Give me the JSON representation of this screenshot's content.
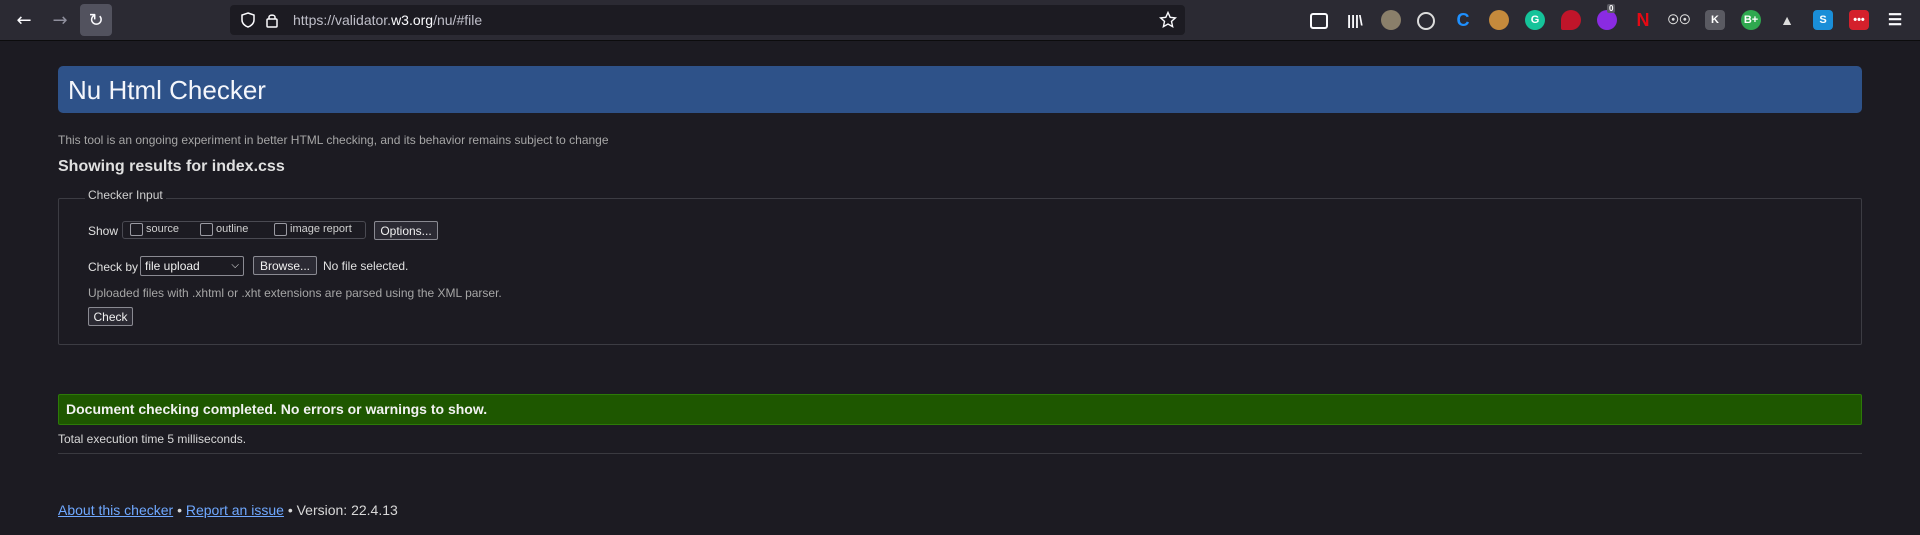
{
  "browser": {
    "back_icon": "arrow-left-icon",
    "forward_icon": "arrow-right-icon",
    "reload_icon": "reload-icon",
    "url_prefix": "https://validator.",
    "url_domain": "w3.org",
    "url_path": "/nu/#file",
    "extension_badge": "0",
    "colors": {
      "toolbar": "#2b2a33",
      "urlbar": "#1c1b22"
    }
  },
  "banner": {
    "title": "Nu Html Checker",
    "color": "#2e5289"
  },
  "intro": "This tool is an ongoing experiment in better HTML checking, and its behavior remains subject to change",
  "results_heading": "Showing results for index.css",
  "form": {
    "legend": "Checker Input",
    "show_label": "Show",
    "options": [
      {
        "label": "source",
        "checked": false
      },
      {
        "label": "outline",
        "checked": false
      },
      {
        "label": "image report",
        "checked": false
      }
    ],
    "options_button": "Options...",
    "check_by_label": "Check by",
    "check_by_value": "file upload",
    "browse_button": "Browse...",
    "file_status": "No file selected.",
    "hint": "Uploaded files with .xhtml or .xht extensions are parsed using the XML parser.",
    "check_button": "Check"
  },
  "result": {
    "message": "Document checking completed. No errors or warnings to show.",
    "color": "#1e5700",
    "exec_time": "Total execution time 5 milliseconds."
  },
  "footer": {
    "about_link": "About this checker",
    "separator": "•",
    "report_link": "Report an issue",
    "version": "• Version: 22.4.13"
  }
}
